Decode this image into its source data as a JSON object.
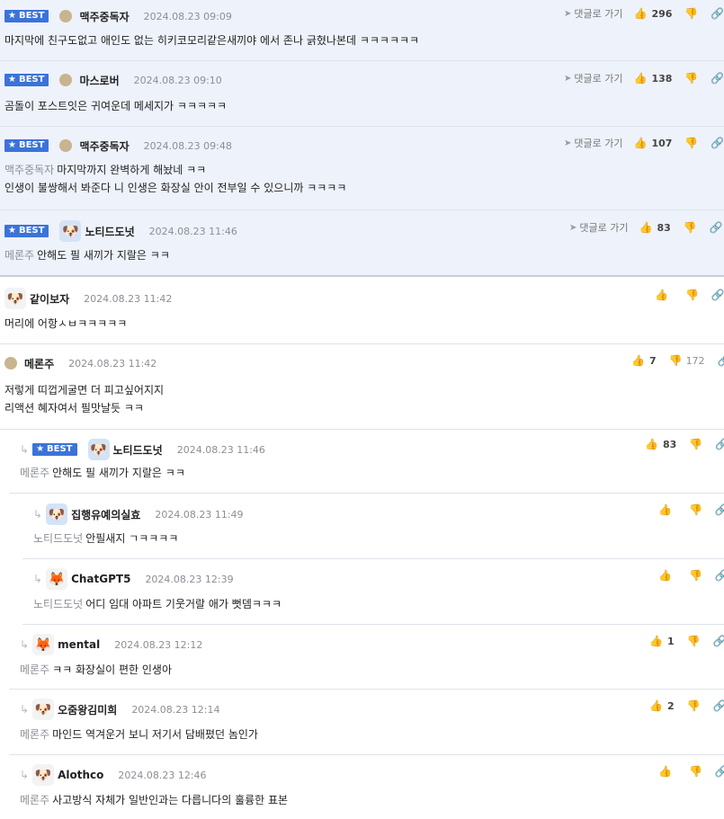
{
  "labels": {
    "best": "BEST",
    "goto": "댓글로 가기"
  },
  "icons": {
    "star": "star-icon",
    "arrow": "navigate-arrow-icon",
    "like": "thumbs-up-icon",
    "dislike": "thumbs-down-icon",
    "link": "link-icon",
    "reply": "reply-arrow-icon"
  },
  "colors": {
    "best_badge": "#3b73d9",
    "best_bg": "#eef2fb",
    "mention": "#8b8f96"
  },
  "comments": [
    {
      "nick": "맥주중독자",
      "date": "2024.08.23 09:09",
      "likes": "296",
      "line1": "마지막에 친구도없고 애인도 없는 히키코모리같은새끼야 에서 존나 긁혔나본데 ㅋㅋㅋㅋㅋㅋ"
    },
    {
      "nick": "마스로버",
      "date": "2024.08.23 09:10",
      "likes": "138",
      "line1": "곰돌이 포스트잇은 귀여운데 메세지가 ㅋㅋㅋㅋㅋ"
    },
    {
      "nick": "맥주중독자",
      "date": "2024.08.23 09:48",
      "likes": "107",
      "mention": "맥주중독자",
      "line1": "마지막까지 완벽하게 해놨네 ㅋㅋ",
      "line2": "인생이 불쌍해서 봐준다 니 인생은 화장실 안이 전부일 수 있으니까 ㅋㅋㅋㅋ"
    },
    {
      "nick": "노티드도넛",
      "date": "2024.08.23 11:46",
      "likes": "83",
      "mention": "메론주",
      "line1": "안해도 필 새끼가 지랄은 ㅋㅋ"
    },
    {
      "nick": "같이보자",
      "date": "2024.08.23 11:42",
      "line1": "머리에 어항ㅅㅂㅋㅋㅋㅋㅋ"
    },
    {
      "nick": "메론주",
      "date": "2024.08.23 11:42",
      "likes": "7",
      "dislikes": "172",
      "line1": "저렇게 띠껍게굴면 더 피고싶어지지",
      "line2": "리액션 혜자여서 필맛날듯 ㅋㅋ"
    },
    {
      "nick": "노티드도넛",
      "date": "2024.08.23 11:46",
      "likes": "83",
      "mention": "메론주",
      "line1": "안해도 필 새끼가 지랄은 ㅋㅋ"
    },
    {
      "nick": "집행유예의실효",
      "date": "2024.08.23 11:49",
      "mention": "노티드도넛",
      "line1": "안필새지 ㄱㅋㅋㅋㅋ"
    },
    {
      "nick": "ChatGPT5",
      "date": "2024.08.23 12:39",
      "mention": "노티드도넛",
      "line1": "어디 임대 아파트 기웃거랄 애가 뻣뎀ㅋㅋㅋ"
    },
    {
      "nick": "mental",
      "date": "2024.08.23 12:12",
      "likes": "1",
      "mention": "메론주",
      "line1": "ㅋㅋ 화장실이 편한 인생아"
    },
    {
      "nick": "오줌왕김미희",
      "date": "2024.08.23 12:14",
      "likes": "2",
      "mention": "메론주",
      "line1": "마인드 역겨운거 보니 저기서 담배폈던 놈인가"
    },
    {
      "nick": "Alothco",
      "date": "2024.08.23 12:46",
      "mention": "메론주",
      "line1": "사고방식 자체가 일반인과는 다릅니다의 훌륭한 표본"
    }
  ]
}
